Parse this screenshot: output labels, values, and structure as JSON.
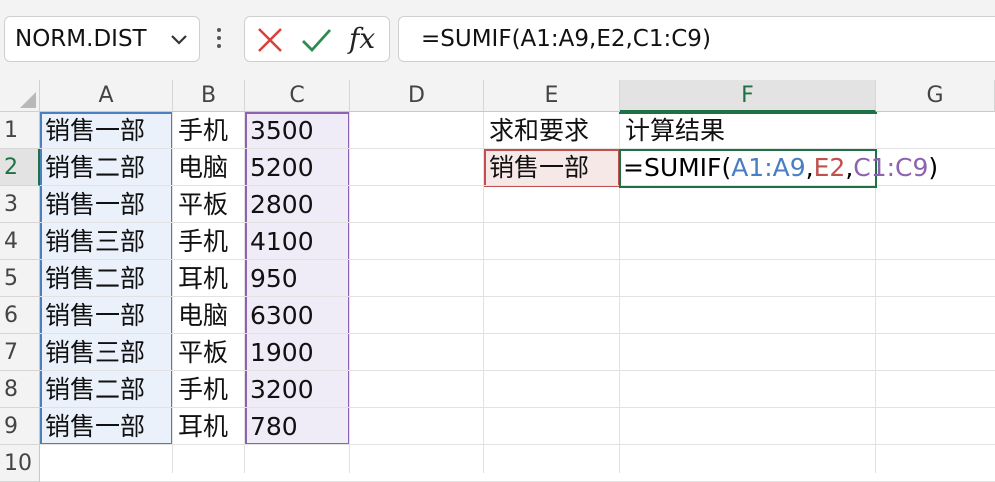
{
  "name_box": {
    "value": "NORM.DIST"
  },
  "formula_bar": {
    "cancel_icon": "x-icon",
    "enter_icon": "check-icon",
    "function_label": "fx",
    "formula": "=SUMIF(A1:A9,E2,C1:C9)"
  },
  "columns": [
    "A",
    "B",
    "C",
    "D",
    "E",
    "F",
    "G"
  ],
  "selected_column": "F",
  "rows": [
    "1",
    "2",
    "3",
    "4",
    "5",
    "6",
    "7",
    "8",
    "9",
    "10"
  ],
  "selected_row": "2",
  "cells": {
    "A": [
      "销售一部",
      "销售二部",
      "销售一部",
      "销售三部",
      "销售二部",
      "销售一部",
      "销售三部",
      "销售二部",
      "销售一部"
    ],
    "B": [
      "手机",
      "电脑",
      "平板",
      "手机",
      "耳机",
      "电脑",
      "平板",
      "手机",
      "耳机"
    ],
    "C": [
      "3500",
      "5200",
      "2800",
      "4100",
      "950",
      "6300",
      "1900",
      "3200",
      "780"
    ],
    "E1": "求和要求",
    "F1": "计算结果",
    "E2": "销售一部"
  },
  "edit_formula": {
    "prefix": "=SUMIF(",
    "arg1": "A1:A9",
    "sep1": ",",
    "arg2": "E2",
    "sep2": ",",
    "arg3": "C1:C9",
    "suffix": ")"
  },
  "colors": {
    "range_a": "#4a7ec2",
    "range_e": "#c0504d",
    "range_c": "#8d62b0",
    "selection": "#1e7145"
  }
}
